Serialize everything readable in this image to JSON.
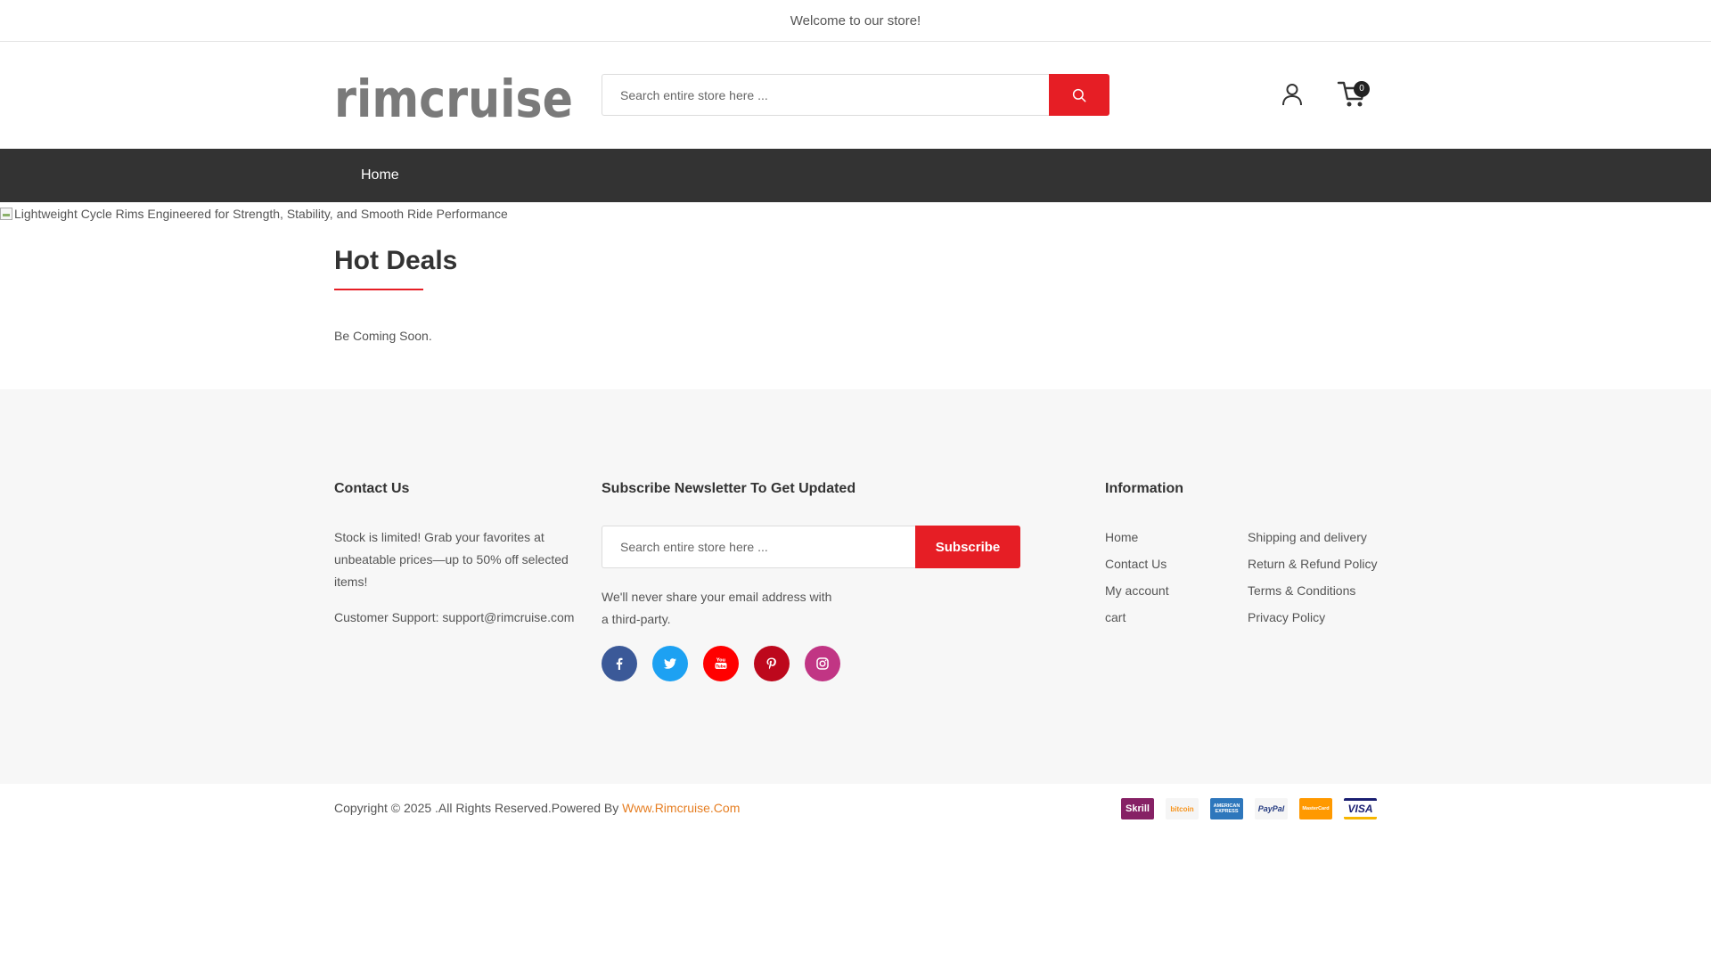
{
  "topbar": {
    "welcome": "Welcome to our store!"
  },
  "header": {
    "logo_text": "rimcruise",
    "search_placeholder": "Search entire store here ...",
    "cart_count": "0"
  },
  "nav": {
    "items": [
      {
        "label": "Home"
      }
    ]
  },
  "banner": {
    "alt_text": "Lightweight Cycle Rims Engineered for Strength, Stability, and Smooth Ride Performance"
  },
  "main": {
    "title": "Hot Deals",
    "message": "Be Coming Soon."
  },
  "footer": {
    "contact": {
      "heading": "Contact Us",
      "text": "Stock is limited! Grab your favorites at unbeatable prices—up to 50% off selected items!",
      "support": "Customer Support: support@rimcruise.com"
    },
    "newsletter": {
      "heading": "Subscribe Newsletter To Get Updated",
      "placeholder": "Search entire store here ...",
      "button_label": "Subscribe",
      "privacy_note": "We'll never share your email address with a third-party."
    },
    "social": [
      {
        "name": "facebook-icon",
        "color": "#3b5998",
        "glyph": "f"
      },
      {
        "name": "twitter-icon",
        "color": "#1da1f2",
        "glyph": ""
      },
      {
        "name": "youtube-icon",
        "color": "#ff0000",
        "glyph": ""
      },
      {
        "name": "pinterest-icon",
        "color": "#bd081c",
        "glyph": ""
      },
      {
        "name": "instagram-icon",
        "color": "#c13584",
        "glyph": ""
      }
    ],
    "information": {
      "heading": "Information",
      "col1": [
        "Home",
        "Contact Us",
        "My account",
        "cart"
      ],
      "col2": [
        "Shipping and delivery",
        "Return & Refund Policy",
        "Terms & Conditions",
        "Privacy Policy"
      ]
    }
  },
  "bottom": {
    "copyright_prefix": "Copyright © 2025 .All Rights Reserved.Powered By ",
    "powered_link": "Www.Rimcruise.Com",
    "payments": [
      {
        "label": "Skrill",
        "bg": "#862165",
        "fg": "#ffffff"
      },
      {
        "label": "bitcoin",
        "bg": "#f5f5f5",
        "fg": "#f7931a"
      },
      {
        "label": "AMERICAN EXPRESS",
        "bg": "#2e77bc",
        "fg": "#ffffff"
      },
      {
        "label": "PayPal",
        "bg": "#f5f5f5",
        "fg": "#253b80"
      },
      {
        "label": "MasterCard",
        "bg": "#ff9900",
        "fg": "#ffffff"
      },
      {
        "label": "VISA",
        "bg": "#ffffff",
        "fg": "#1a1f71"
      }
    ]
  }
}
